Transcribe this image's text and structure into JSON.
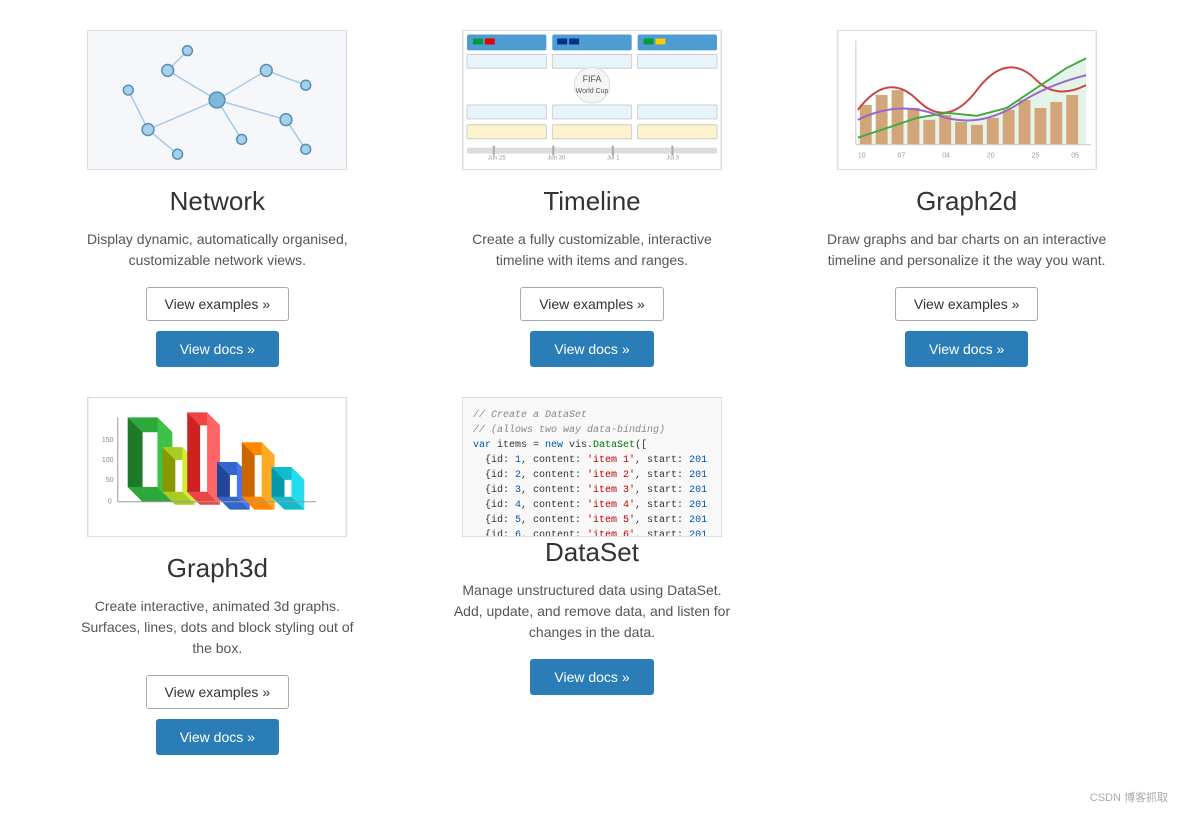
{
  "cards": [
    {
      "id": "network",
      "title": "Network",
      "description": "Display dynamic, automatically organised, customizable network views.",
      "examples_label": "View examples »",
      "docs_label": "View docs »"
    },
    {
      "id": "timeline",
      "title": "Timeline",
      "description": "Create a fully customizable, interactive timeline with items and ranges.",
      "examples_label": "View examples »",
      "docs_label": "View docs »"
    },
    {
      "id": "graph2d",
      "title": "Graph2d",
      "description": "Draw graphs and bar charts on an interactive timeline and personalize it the way you want.",
      "examples_label": "View examples »",
      "docs_label": "View docs »"
    },
    {
      "id": "graph3d",
      "title": "Graph3d",
      "description": "Create interactive, animated 3d graphs. Surfaces, lines, dots and block styling out of the box.",
      "examples_label": "View examples »",
      "docs_label": "View docs »"
    },
    {
      "id": "dataset",
      "title": "DataSet",
      "description": "Manage unstructured data using DataSet. Add, update, and remove data, and listen for changes in the data.",
      "examples_label": null,
      "docs_label": "View docs »"
    }
  ],
  "footer": {
    "note": "CSDN 博客抓取"
  }
}
